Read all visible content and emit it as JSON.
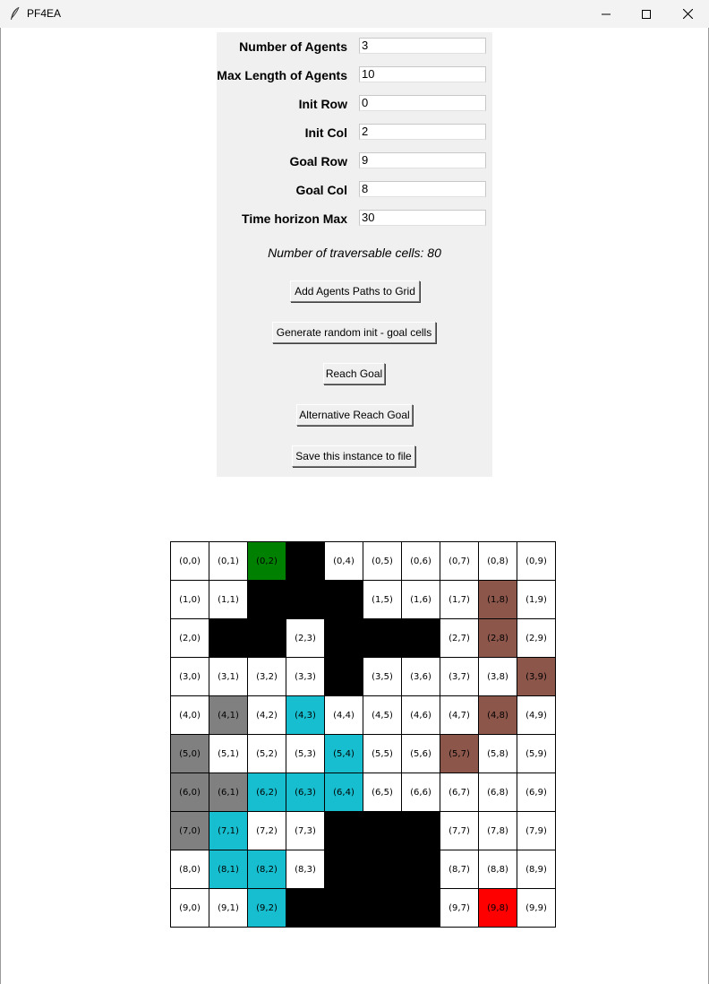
{
  "window": {
    "title": "PF4EA"
  },
  "form": {
    "fields": [
      {
        "label": "Number of Agents",
        "value": "3"
      },
      {
        "label": "Max Length of Agents",
        "value": "10"
      },
      {
        "label": "Init Row",
        "value": "0"
      },
      {
        "label": "Init Col",
        "value": "2"
      },
      {
        "label": "Goal Row",
        "value": "9"
      },
      {
        "label": "Goal Col",
        "value": "8"
      },
      {
        "label": "Time horizon Max",
        "value": "30"
      }
    ],
    "info_text": "Number of traversable cells: 80",
    "buttons": [
      {
        "label": "Add Agents Paths to Grid"
      },
      {
        "label": "Generate random init - goal cells"
      },
      {
        "label": "Reach Goal"
      },
      {
        "label": "Alternative Reach Goal"
      },
      {
        "label": "Save this instance to file"
      }
    ]
  },
  "grid": {
    "rows": 10,
    "cols": 10,
    "colors": {
      "free": "#ffffff",
      "obstacle": "#000000",
      "init": "#008000",
      "goal": "#ff0000",
      "agent_gray": "#808080",
      "agent_cyan": "#17becf",
      "agent_brown": "#8c564b"
    },
    "cell_types": [
      [
        "free",
        "free",
        "init",
        "obstacle",
        "free",
        "free",
        "free",
        "free",
        "free",
        "free"
      ],
      [
        "free",
        "free",
        "obstacle",
        "obstacle",
        "obstacle",
        "free",
        "free",
        "free",
        "agent_brown",
        "free"
      ],
      [
        "free",
        "obstacle",
        "obstacle",
        "free",
        "obstacle",
        "obstacle",
        "obstacle",
        "free",
        "agent_brown",
        "free"
      ],
      [
        "free",
        "free",
        "free",
        "free",
        "obstacle",
        "free",
        "free",
        "free",
        "free",
        "agent_brown"
      ],
      [
        "free",
        "agent_gray",
        "free",
        "agent_cyan",
        "free",
        "free",
        "free",
        "free",
        "agent_brown",
        "free"
      ],
      [
        "agent_gray",
        "free",
        "free",
        "free",
        "agent_cyan",
        "free",
        "free",
        "agent_brown",
        "free",
        "free"
      ],
      [
        "agent_gray",
        "agent_gray",
        "agent_cyan",
        "agent_cyan",
        "agent_cyan",
        "free",
        "free",
        "free",
        "free",
        "free"
      ],
      [
        "agent_gray",
        "agent_cyan",
        "free",
        "free",
        "obstacle",
        "obstacle",
        "obstacle",
        "free",
        "free",
        "free"
      ],
      [
        "free",
        "agent_cyan",
        "agent_cyan",
        "free",
        "obstacle",
        "obstacle",
        "obstacle",
        "free",
        "free",
        "free"
      ],
      [
        "free",
        "free",
        "agent_cyan",
        "obstacle",
        "obstacle",
        "obstacle",
        "obstacle",
        "free",
        "goal",
        "free"
      ]
    ]
  }
}
